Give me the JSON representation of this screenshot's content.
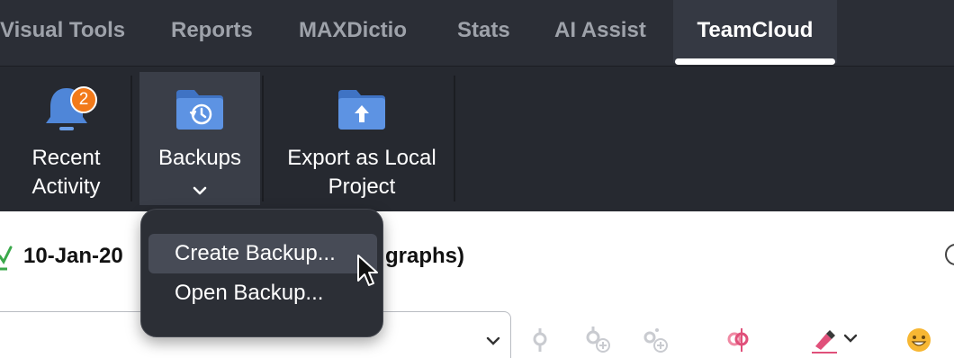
{
  "tabs": [
    {
      "label": "Visual Tools",
      "active": false
    },
    {
      "label": "Reports",
      "active": false
    },
    {
      "label": "MAXDictio",
      "active": false
    },
    {
      "label": "Stats",
      "active": false
    },
    {
      "label": "AI Assist",
      "active": false
    },
    {
      "label": "TeamCloud",
      "active": true
    }
  ],
  "ribbon": {
    "recent_activity": {
      "line1": "Recent",
      "line2": "Activity",
      "badge": "2",
      "icon": "bell-icon"
    },
    "backups": {
      "label": "Backups",
      "icon": "folder-history-icon",
      "dropdown_icon": "chevron-down-icon"
    },
    "export": {
      "line1": "Export as Local",
      "line2": "Project",
      "icon": "folder-upload-icon"
    }
  },
  "document": {
    "title_start": "10-Jan-20",
    "title_end": "graphs)"
  },
  "menu": {
    "items": [
      "Create Backup...",
      "Open Backup..."
    ],
    "highlighted_index": 0
  },
  "colors": {
    "tabbar_bg": "#2b2e36",
    "ribbon_bg": "#262930",
    "folder_blue": "#4f86d8",
    "badge_orange": "#f27a1a",
    "highlighter_pink": "#e0507a",
    "emoji_yellow": "#f7b733"
  }
}
